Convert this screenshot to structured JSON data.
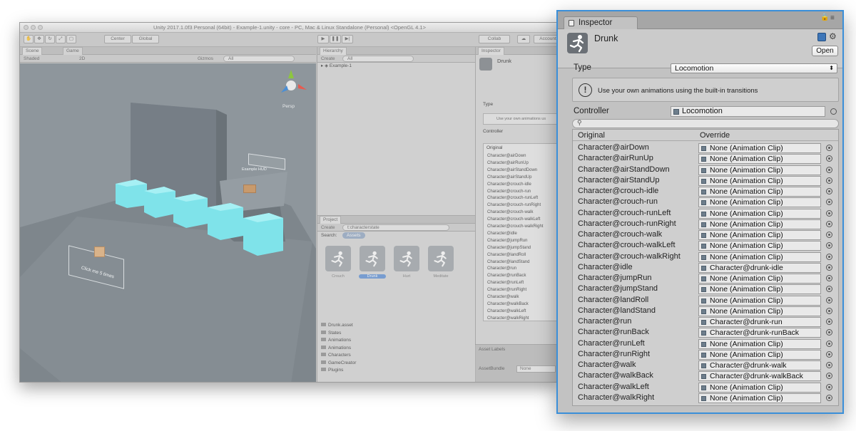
{
  "window": {
    "title": "Unity 2017.1.0f3 Personal (64bit) - Example-1.unity - core - PC, Mac & Linux Standalone (Personal) <OpenGL 4.1>"
  },
  "toolbar": {
    "center_label": "Center",
    "global_label": "Global",
    "collab_label": "Collab",
    "account_label": "Account"
  },
  "scene_panel": {
    "tabs": [
      "Scene",
      "Game"
    ],
    "shading": "Shaded",
    "mode_2d": "2D",
    "gizmos_label": "Gizmos",
    "search_placeholder": "All",
    "persp_label": "Persp",
    "hud_label": "Example HUD",
    "click_text": "Click me 5 times"
  },
  "hierarchy": {
    "tab": "Hierarchy",
    "create_label": "Create",
    "search_placeholder": "All",
    "scene_name": "Example-1"
  },
  "project": {
    "tab": "Project",
    "create_label": "Create",
    "search_value": "t:characterstate",
    "search_label": "Search:",
    "assets_chip": "Assets",
    "assets": [
      "Crouch",
      "Drunk",
      "Hurt",
      "Meditate"
    ],
    "selected_asset": "Drunk",
    "tree": [
      "Drunk.asset",
      "States",
      "Animations",
      "Animations",
      "Characters",
      "GameCreator",
      "Plugins"
    ],
    "asset_labels": "Asset Labels",
    "asset_bundle_label": "AssetBundle",
    "asset_bundle_value": "None"
  },
  "inspector": {
    "tab": "Inspector",
    "object_name": "Drunk",
    "open_label": "Open",
    "type_label": "Type",
    "type_value": "Locomotion",
    "info_text": "Use your own animations using the built-in transitions",
    "small_info_text": "Use your own animations us",
    "controller_label": "Controller",
    "controller_value": "Locomotion",
    "col_original": "Original",
    "col_override": "Override",
    "rows": [
      {
        "original": "Character@airDown",
        "override": "None (Animation Clip)"
      },
      {
        "original": "Character@airRunUp",
        "override": "None (Animation Clip)"
      },
      {
        "original": "Character@airStandDown",
        "override": "None (Animation Clip)"
      },
      {
        "original": "Character@airStandUp",
        "override": "None (Animation Clip)"
      },
      {
        "original": "Character@crouch-idle",
        "override": "None (Animation Clip)"
      },
      {
        "original": "Character@crouch-run",
        "override": "None (Animation Clip)"
      },
      {
        "original": "Character@crouch-runLeft",
        "override": "None (Animation Clip)"
      },
      {
        "original": "Character@crouch-runRight",
        "override": "None (Animation Clip)"
      },
      {
        "original": "Character@crouch-walk",
        "override": "None (Animation Clip)"
      },
      {
        "original": "Character@crouch-walkLeft",
        "override": "None (Animation Clip)"
      },
      {
        "original": "Character@crouch-walkRight",
        "override": "None (Animation Clip)"
      },
      {
        "original": "Character@idle",
        "override": "Character@drunk-idle"
      },
      {
        "original": "Character@jumpRun",
        "override": "None (Animation Clip)"
      },
      {
        "original": "Character@jumpStand",
        "override": "None (Animation Clip)"
      },
      {
        "original": "Character@landRoll",
        "override": "None (Animation Clip)"
      },
      {
        "original": "Character@landStand",
        "override": "None (Animation Clip)"
      },
      {
        "original": "Character@run",
        "override": "Character@drunk-run"
      },
      {
        "original": "Character@runBack",
        "override": "Character@drunk-runBack"
      },
      {
        "original": "Character@runLeft",
        "override": "None (Animation Clip)"
      },
      {
        "original": "Character@runRight",
        "override": "None (Animation Clip)"
      },
      {
        "original": "Character@walk",
        "override": "Character@drunk-walk"
      },
      {
        "original": "Character@walkBack",
        "override": "Character@drunk-walkBack"
      },
      {
        "original": "Character@walkLeft",
        "override": "None (Animation Clip)"
      },
      {
        "original": "Character@walkRight",
        "override": "None (Animation Clip)"
      }
    ]
  },
  "colors": {
    "accent": "#3a8fd9",
    "cube": "#7fe3ea",
    "scene_bg": "#8e969c"
  }
}
